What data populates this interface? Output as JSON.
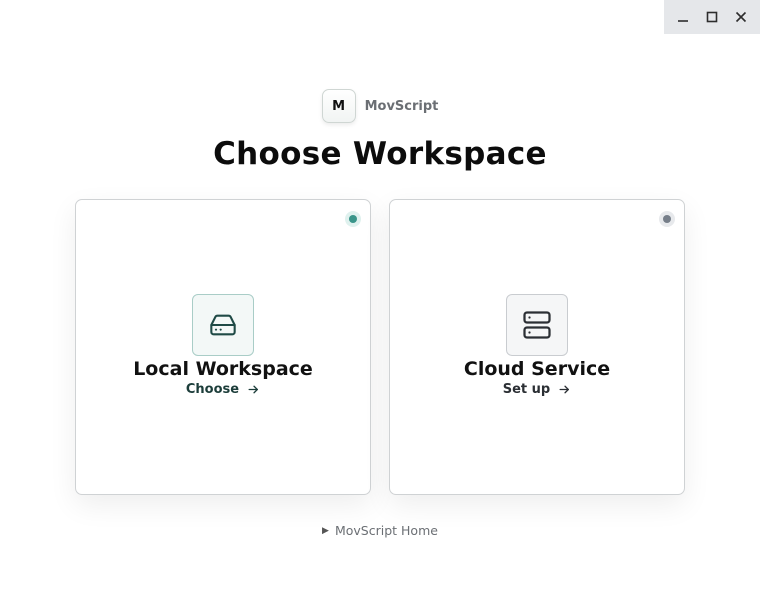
{
  "brand": {
    "logo_letter": "M",
    "name": "MovScript"
  },
  "page_title": "Choose Workspace",
  "cards": [
    {
      "title": "Local Workspace",
      "action": "Choose",
      "icon": "hard-drive-icon",
      "status_color": "#3a958a",
      "accent": "#1c3d3a"
    },
    {
      "title": "Cloud Service",
      "action": "Set up",
      "icon": "server-icon",
      "status_color": "#767e89",
      "accent": "#2b2f34"
    }
  ],
  "footer": {
    "link": "MovScript Home",
    "icon": "triangle-right-icon"
  },
  "window_controls": [
    "minimize-icon",
    "maximize-icon",
    "close-icon"
  ]
}
